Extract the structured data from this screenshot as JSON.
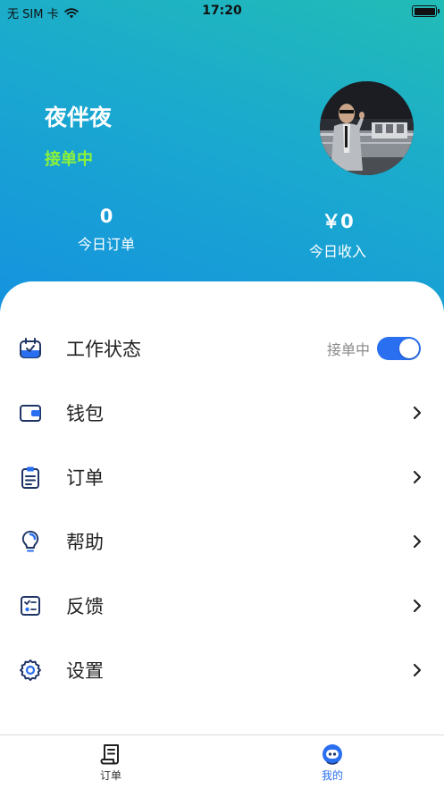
{
  "status_bar": {
    "carrier": "无 SIM 卡",
    "time": "17:20"
  },
  "profile": {
    "name": "夜伴夜",
    "work_badge": "接单中",
    "avatar_icon": "user-photo"
  },
  "stats": {
    "today_orders_value": "0",
    "today_orders_label": "今日订单",
    "today_income_value": "￥0",
    "today_income_label": "今日收入"
  },
  "menu": {
    "work_status": {
      "label": "工作状态",
      "status_text": "接单中",
      "toggle_on": true,
      "icon": "calendar-check-icon"
    },
    "wallet": {
      "label": "钱包",
      "icon": "wallet-icon"
    },
    "orders": {
      "label": "订单",
      "icon": "clipboard-icon"
    },
    "help": {
      "label": "帮助",
      "icon": "lightbulb-icon"
    },
    "feedback": {
      "label": "反馈",
      "icon": "checklist-icon"
    },
    "settings": {
      "label": "设置",
      "icon": "gear-icon"
    }
  },
  "tabbar": {
    "orders_label": "订单",
    "mine_label": "我的",
    "active_tab": "我的"
  },
  "colors": {
    "header_gradient_start": "#22bcb6",
    "header_gradient_end": "#1592df",
    "badge_green": "#8cf23a",
    "accent_blue": "#2a6ff0",
    "icon_navy": "#1f3566"
  }
}
